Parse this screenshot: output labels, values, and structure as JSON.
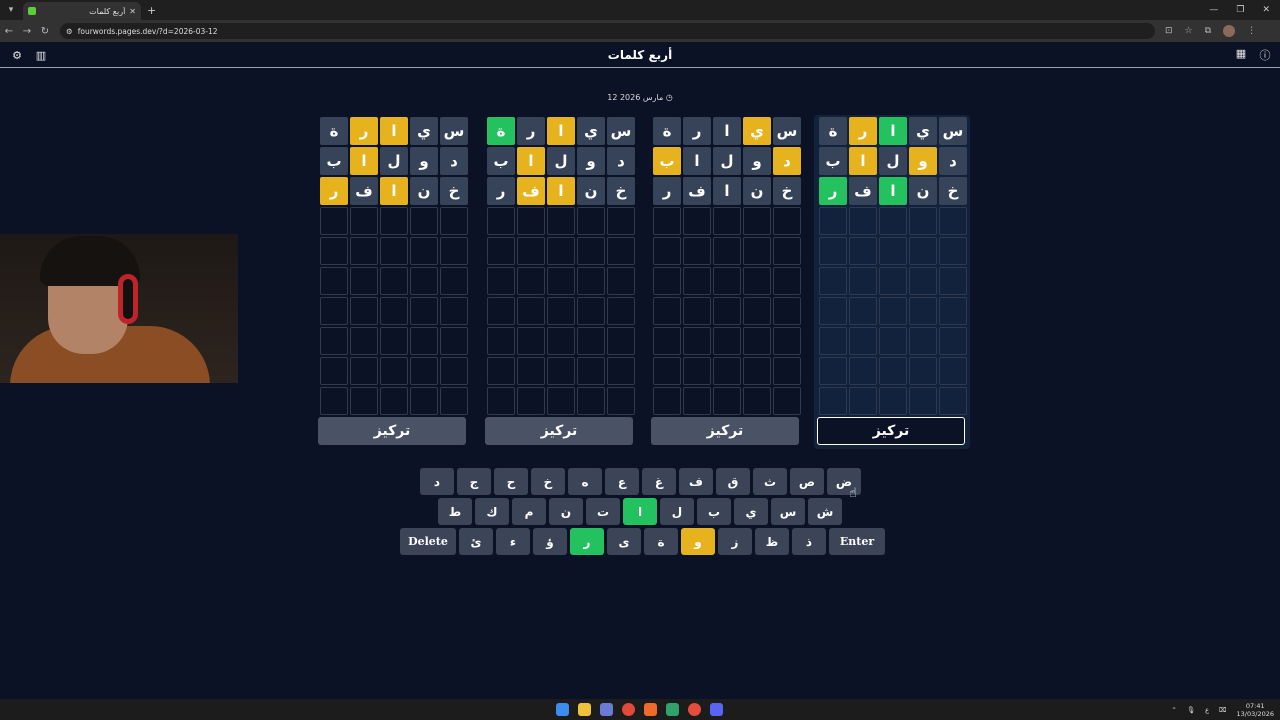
{
  "browser": {
    "tab_title": "أربع كلمات",
    "url": "fourwords.pages.dev/?d=2026-03-12"
  },
  "header": {
    "title": "أربع كلمات"
  },
  "date": "12 مارس 2026",
  "boards": [
    {
      "rows": [
        [
          {
            "l": "س",
            "s": "g"
          },
          {
            "l": "ي",
            "s": "g"
          },
          {
            "l": "ا",
            "s": "gr"
          },
          {
            "l": "ر",
            "s": "y"
          },
          {
            "l": "ة",
            "s": "g"
          }
        ],
        [
          {
            "l": "د",
            "s": "g"
          },
          {
            "l": "و",
            "s": "y"
          },
          {
            "l": "ل",
            "s": "g"
          },
          {
            "l": "ا",
            "s": "y"
          },
          {
            "l": "ب",
            "s": "g"
          }
        ],
        [
          {
            "l": "خ",
            "s": "g"
          },
          {
            "l": "ن",
            "s": "g"
          },
          {
            "l": "ا",
            "s": "gr"
          },
          {
            "l": "ف",
            "s": "g"
          },
          {
            "l": "ر",
            "s": "gr"
          }
        ]
      ],
      "focus_label": "تركيز",
      "selected": true
    },
    {
      "rows": [
        [
          {
            "l": "س",
            "s": "g"
          },
          {
            "l": "ي",
            "s": "y"
          },
          {
            "l": "ا",
            "s": "g"
          },
          {
            "l": "ر",
            "s": "g"
          },
          {
            "l": "ة",
            "s": "g"
          }
        ],
        [
          {
            "l": "د",
            "s": "y"
          },
          {
            "l": "و",
            "s": "g"
          },
          {
            "l": "ل",
            "s": "g"
          },
          {
            "l": "ا",
            "s": "g"
          },
          {
            "l": "ب",
            "s": "y"
          }
        ],
        [
          {
            "l": "خ",
            "s": "g"
          },
          {
            "l": "ن",
            "s": "g"
          },
          {
            "l": "ا",
            "s": "g"
          },
          {
            "l": "ف",
            "s": "g"
          },
          {
            "l": "ر",
            "s": "g"
          }
        ]
      ],
      "focus_label": "تركيز",
      "selected": false
    },
    {
      "rows": [
        [
          {
            "l": "س",
            "s": "g"
          },
          {
            "l": "ي",
            "s": "g"
          },
          {
            "l": "ا",
            "s": "y"
          },
          {
            "l": "ر",
            "s": "g"
          },
          {
            "l": "ة",
            "s": "gr"
          }
        ],
        [
          {
            "l": "د",
            "s": "g"
          },
          {
            "l": "و",
            "s": "g"
          },
          {
            "l": "ل",
            "s": "g"
          },
          {
            "l": "ا",
            "s": "y"
          },
          {
            "l": "ب",
            "s": "g"
          }
        ],
        [
          {
            "l": "خ",
            "s": "g"
          },
          {
            "l": "ن",
            "s": "g"
          },
          {
            "l": "ا",
            "s": "y"
          },
          {
            "l": "ف",
            "s": "y"
          },
          {
            "l": "ر",
            "s": "g"
          }
        ]
      ],
      "focus_label": "تركيز",
      "selected": false
    },
    {
      "rows": [
        [
          {
            "l": "س",
            "s": "g"
          },
          {
            "l": "ي",
            "s": "g"
          },
          {
            "l": "ا",
            "s": "y"
          },
          {
            "l": "ر",
            "s": "y"
          },
          {
            "l": "ة",
            "s": "g"
          }
        ],
        [
          {
            "l": "د",
            "s": "g"
          },
          {
            "l": "و",
            "s": "g"
          },
          {
            "l": "ل",
            "s": "g"
          },
          {
            "l": "ا",
            "s": "y"
          },
          {
            "l": "ب",
            "s": "g"
          }
        ],
        [
          {
            "l": "خ",
            "s": "g"
          },
          {
            "l": "ن",
            "s": "g"
          },
          {
            "l": "ا",
            "s": "y"
          },
          {
            "l": "ف",
            "s": "g"
          },
          {
            "l": "ر",
            "s": "y"
          }
        ]
      ],
      "focus_label": "تركيز",
      "selected": false
    }
  ],
  "keyboard": {
    "row1": [
      {
        "k": "ض",
        "s": ""
      },
      {
        "k": "ص",
        "s": ""
      },
      {
        "k": "ث",
        "s": ""
      },
      {
        "k": "ق",
        "s": ""
      },
      {
        "k": "ف",
        "s": ""
      },
      {
        "k": "غ",
        "s": ""
      },
      {
        "k": "ع",
        "s": ""
      },
      {
        "k": "ه",
        "s": ""
      },
      {
        "k": "خ",
        "s": ""
      },
      {
        "k": "ح",
        "s": ""
      },
      {
        "k": "ج",
        "s": ""
      },
      {
        "k": "د",
        "s": ""
      }
    ],
    "row2": [
      {
        "k": "ش",
        "s": ""
      },
      {
        "k": "س",
        "s": ""
      },
      {
        "k": "ي",
        "s": ""
      },
      {
        "k": "ب",
        "s": ""
      },
      {
        "k": "ل",
        "s": ""
      },
      {
        "k": "ا",
        "s": "gr"
      },
      {
        "k": "ت",
        "s": ""
      },
      {
        "k": "ن",
        "s": ""
      },
      {
        "k": "م",
        "s": ""
      },
      {
        "k": "ك",
        "s": ""
      },
      {
        "k": "ط",
        "s": ""
      }
    ],
    "row3": [
      {
        "k": "Delete",
        "s": "",
        "wide": true
      },
      {
        "k": "ئ",
        "s": ""
      },
      {
        "k": "ء",
        "s": ""
      },
      {
        "k": "ؤ",
        "s": ""
      },
      {
        "k": "ر",
        "s": "gr"
      },
      {
        "k": "ى",
        "s": ""
      },
      {
        "k": "ة",
        "s": ""
      },
      {
        "k": "و",
        "s": "y"
      },
      {
        "k": "ز",
        "s": ""
      },
      {
        "k": "ظ",
        "s": ""
      },
      {
        "k": "ذ",
        "s": ""
      },
      {
        "k": "Enter",
        "s": "",
        "wide": true
      }
    ]
  },
  "taskbar": {
    "time": "07:41",
    "date": "13/03/2026"
  },
  "colors": {
    "green": "#24c25e",
    "yellow": "#e6b31f",
    "gray": "#374359",
    "bg": "#0b1226"
  }
}
